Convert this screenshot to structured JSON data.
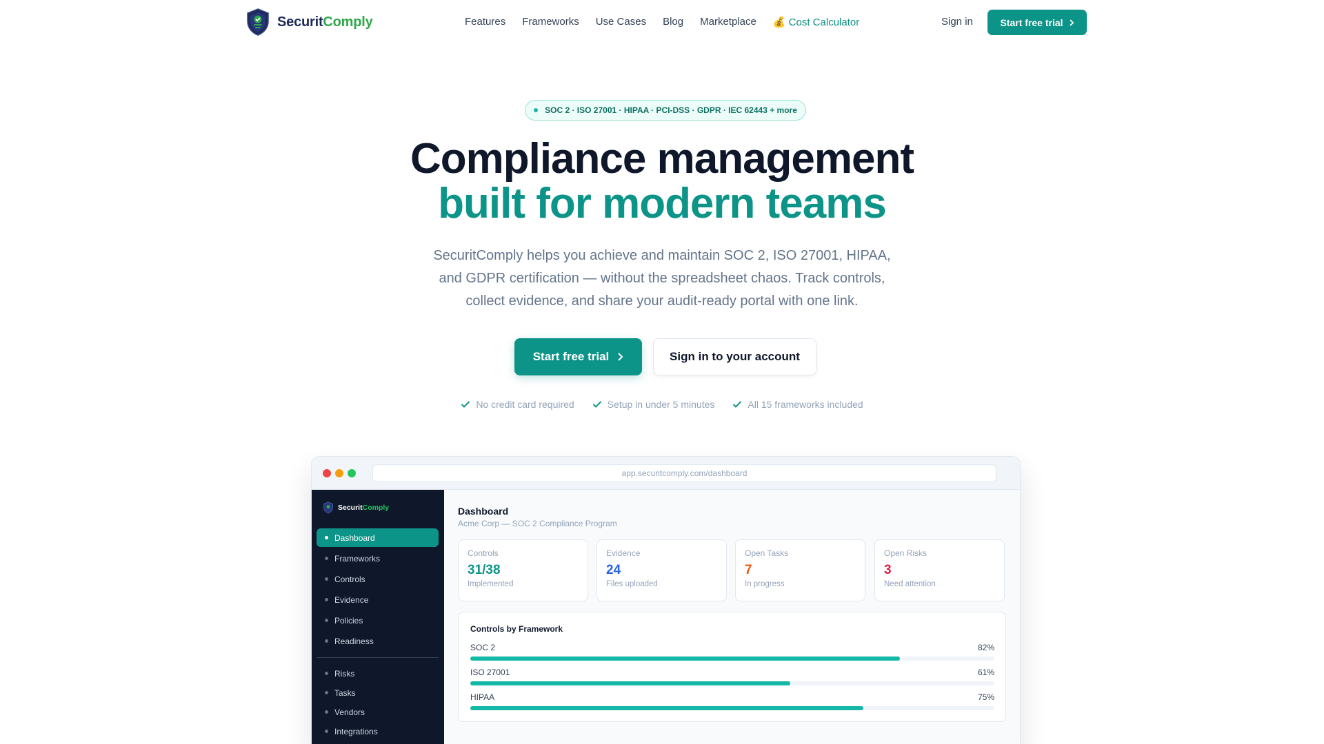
{
  "nav": {
    "brand_a": "Securit",
    "brand_b": "Comply",
    "links": [
      "Features",
      "Frameworks",
      "Use Cases",
      "Blog",
      "Marketplace"
    ],
    "cost_icon": "💰",
    "cost_label": "Cost Calculator",
    "signin": "Sign in",
    "trial": "Start free trial"
  },
  "hero": {
    "pill": "SOC 2 · ISO 27001 · HIPAA · PCI-DSS · GDPR · IEC 62443 + more",
    "title_line1": "Compliance management",
    "title_line2": "built for modern teams",
    "subtitle": "SecuritComply helps you achieve and maintain SOC 2, ISO 27001, HIPAA, and GDPR certification — without the spreadsheet chaos. Track controls, collect evidence, and share your audit-ready portal with one link.",
    "cta_primary": "Start free trial",
    "cta_secondary": "Sign in to your account",
    "checks": [
      "No credit card required",
      "Setup in under 5 minutes",
      "All 15 frameworks included"
    ]
  },
  "mock": {
    "url": "app.securitcomply.com/dashboard",
    "sidebar": {
      "brand_a": "Securit",
      "brand_b": "Comply",
      "items": [
        "Dashboard",
        "Frameworks",
        "Controls",
        "Evidence",
        "Policies",
        "Readiness"
      ],
      "items2": [
        "Risks",
        "Tasks",
        "Vendors",
        "Integrations"
      ]
    },
    "dashboard": {
      "title": "Dashboard",
      "subtitle": "Acme Corp — SOC 2 Compliance Program",
      "stats": [
        {
          "label": "Controls",
          "value": "31/38",
          "note": "Implemented",
          "color": "#0d9488"
        },
        {
          "label": "Evidence",
          "value": "24",
          "note": "Files uploaded",
          "color": "#2563eb"
        },
        {
          "label": "Open Tasks",
          "value": "7",
          "note": "In progress",
          "color": "#ea580c"
        },
        {
          "label": "Open Risks",
          "value": "3",
          "note": "Need attention",
          "color": "#e11d48"
        }
      ],
      "frameworks_title": "Controls by Framework",
      "frameworks": [
        {
          "name": "SOC 2",
          "pct_label": "82%",
          "pct": 0.82
        },
        {
          "name": "ISO 27001",
          "pct_label": "61%",
          "pct": 0.61
        },
        {
          "name": "HIPAA",
          "pct_label": "75%",
          "pct": 0.75
        }
      ]
    }
  },
  "colors": {
    "accent": "#0d9488",
    "navy": "#0f172a",
    "brand_green": "#2ea84a",
    "brand_navy": "#1e2a5a"
  }
}
